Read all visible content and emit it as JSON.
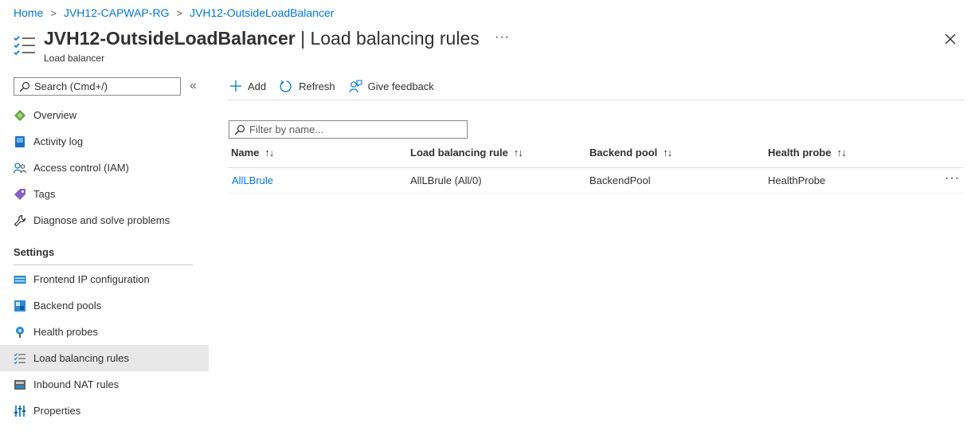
{
  "breadcrumb": {
    "items": [
      "Home",
      "JVH12-CAPWAP-RG",
      "JVH12-OutsideLoadBalancer"
    ]
  },
  "header": {
    "resource_name": "JVH12-OutsideLoadBalancer",
    "page_name": "| Load balancing rules",
    "subtitle": "Load balancer",
    "more": "···"
  },
  "sidebar": {
    "search_placeholder": "Search (Cmd+/)",
    "collapse": "«",
    "items": [
      {
        "label": "Overview",
        "icon": "overview-icon"
      },
      {
        "label": "Activity log",
        "icon": "activity-log-icon"
      },
      {
        "label": "Access control (IAM)",
        "icon": "iam-icon"
      },
      {
        "label": "Tags",
        "icon": "tag-icon"
      },
      {
        "label": "Diagnose and solve problems",
        "icon": "wrench-icon"
      }
    ],
    "settings_header": "Settings",
    "settings_items": [
      {
        "label": "Frontend IP configuration",
        "icon": "frontend-ip-icon"
      },
      {
        "label": "Backend pools",
        "icon": "backend-pools-icon"
      },
      {
        "label": "Health probes",
        "icon": "health-probe-icon"
      },
      {
        "label": "Load balancing rules",
        "icon": "lb-rules-icon",
        "active": true
      },
      {
        "label": "Inbound NAT rules",
        "icon": "nat-rules-icon"
      },
      {
        "label": "Properties",
        "icon": "properties-icon"
      }
    ]
  },
  "toolbar": {
    "add_label": "Add",
    "refresh_label": "Refresh",
    "feedback_label": "Give feedback"
  },
  "filter": {
    "placeholder": "Filter by name..."
  },
  "table": {
    "columns": [
      "Name",
      "Load balancing rule",
      "Backend pool",
      "Health probe"
    ],
    "sort_glyph": "↑↓",
    "rows": [
      {
        "name": "AllLBrule",
        "rule": "AllLBrule (All/0)",
        "pool": "BackendPool",
        "probe": "HealthProbe",
        "more": "···"
      }
    ]
  },
  "colors": {
    "accent": "#0078d4",
    "active_bg": "#e8e8e8"
  }
}
